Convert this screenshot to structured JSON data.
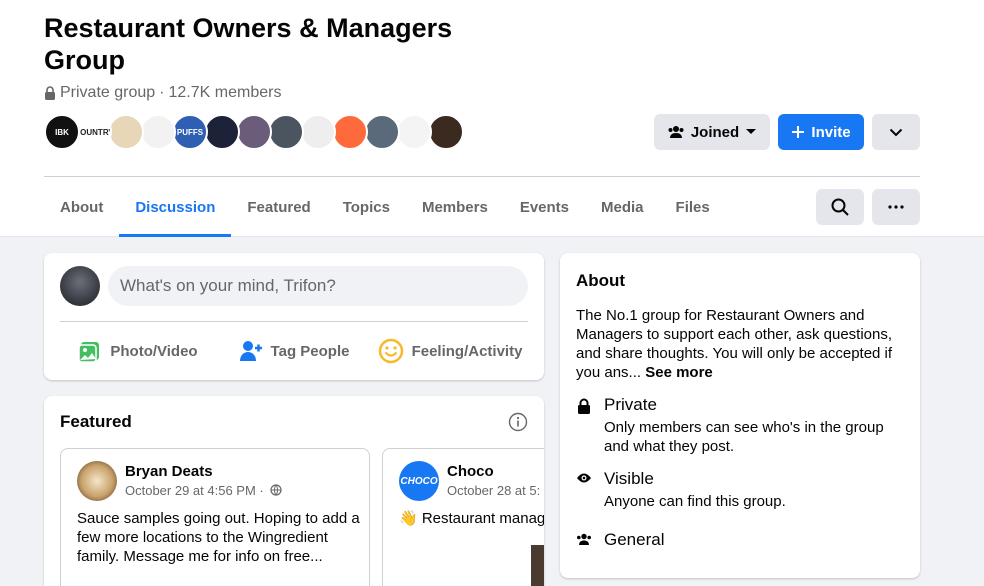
{
  "group": {
    "title": "Restaurant Owners & Managers Group",
    "privacy": "Private group",
    "separator": "·",
    "members": "12.7K members"
  },
  "member_avatars": [
    {
      "label": "IBK",
      "color": "#111111"
    },
    {
      "label": "COUNTRY",
      "color": "#ffffff"
    },
    {
      "label": "",
      "color": "#e8d6b8"
    },
    {
      "label": "",
      "color": "#f2f2f2"
    },
    {
      "label": "PUFFS",
      "color": "#2f5fb3"
    },
    {
      "label": "",
      "color": "#1c2238"
    },
    {
      "label": "",
      "color": "#6a5c7a"
    },
    {
      "label": "",
      "color": "#4a5560"
    },
    {
      "label": "",
      "color": "#eeeeee"
    },
    {
      "label": "",
      "color": "#ff6a3d"
    },
    {
      "label": "",
      "color": "#5a6a7a"
    },
    {
      "label": "",
      "color": "#f4f4f4"
    },
    {
      "label": "",
      "color": "#3a2a20"
    }
  ],
  "buttons": {
    "joined": "Joined",
    "invite": "Invite"
  },
  "tabs": [
    "About",
    "Discussion",
    "Featured",
    "Topics",
    "Members",
    "Events",
    "Media",
    "Files"
  ],
  "active_tab": "Discussion",
  "composer": {
    "placeholder": "What's on your mind, Trifon?",
    "photo": "Photo/Video",
    "tag": "Tag People",
    "feeling": "Feeling/Activity"
  },
  "featured": {
    "title": "Featured",
    "posts": [
      {
        "author": "Bryan Deats",
        "date": "October 29 at 4:56 PM ·",
        "text": "Sauce samples going out. Hoping to add a few more locations to the Wingredient family. Message me for info on free..."
      },
      {
        "author": "Choco",
        "date": "October 28 at 5:",
        "text": "👋 Restaurant manag"
      }
    ]
  },
  "about": {
    "heading": "About",
    "description": "The No.1 group for Restaurant Owners and Managers to support each other, ask questions, and share thoughts. You will only be accepted if you ans...",
    "see_more": "See more",
    "private_title": "Private",
    "private_desc": "Only members can see who's in the group and what they post.",
    "visible_title": "Visible",
    "visible_desc": "Anyone can find this group.",
    "general_title": "General"
  },
  "colors": {
    "accent": "#1877f2",
    "page_bg": "#f0f2f5",
    "secondary_text": "#65676b"
  }
}
